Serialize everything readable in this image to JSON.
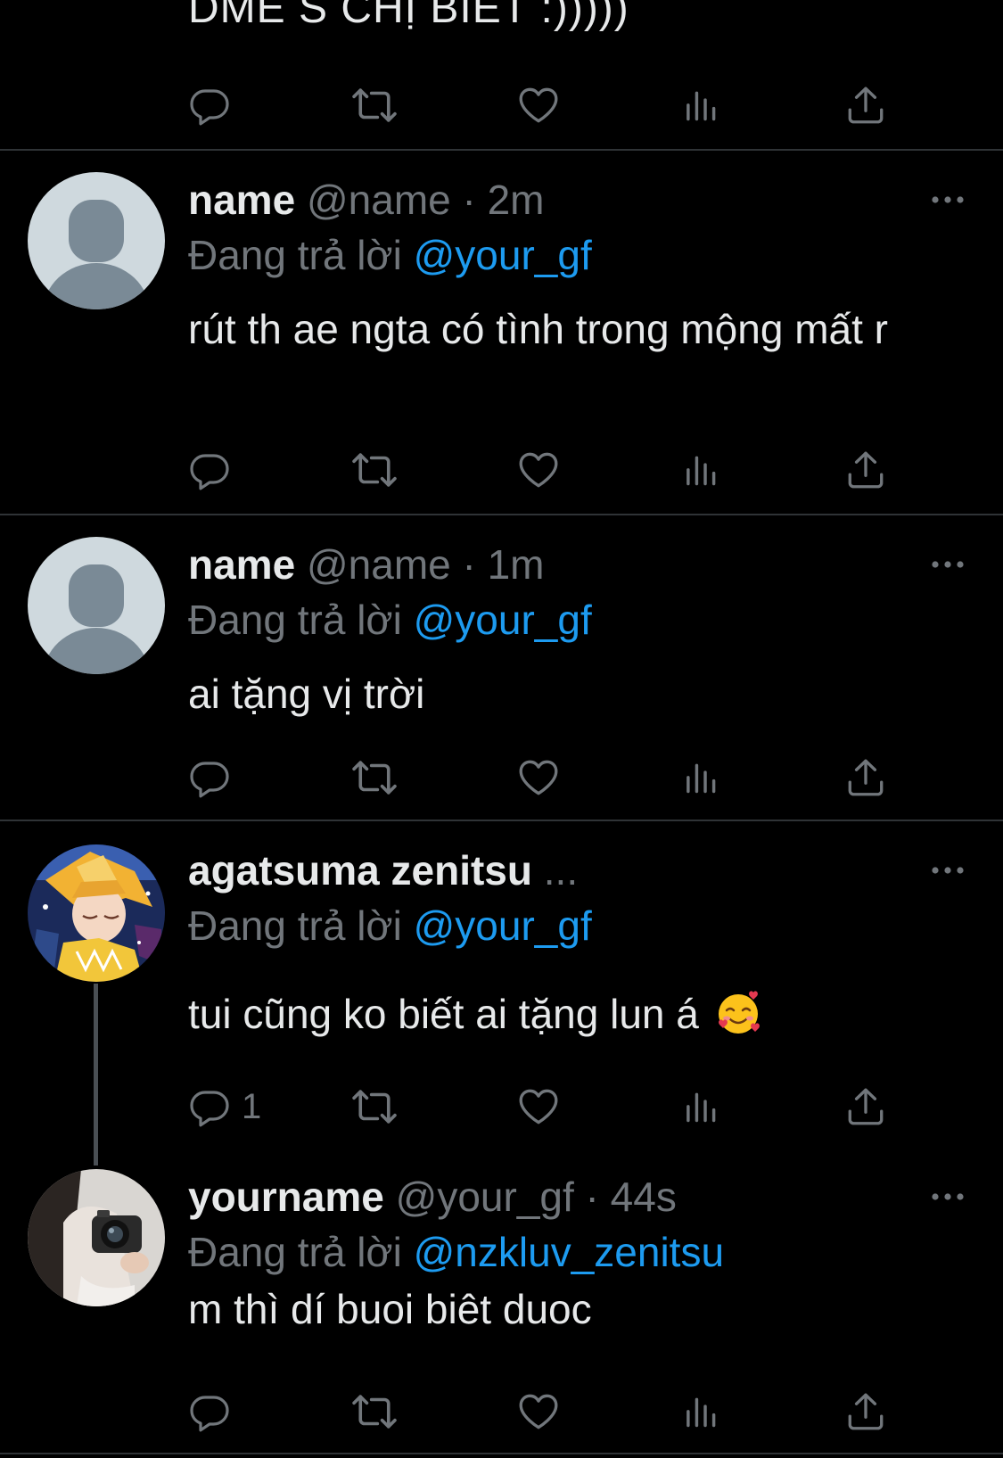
{
  "colors": {
    "background": "#000000",
    "primary_text": "#e7e9ea",
    "secondary_text": "#71767b",
    "link": "#1d9bf0",
    "divider": "#2f3336"
  },
  "top_fragment": {
    "text": "DME S CHỊ BIẾT :)))))"
  },
  "actions_icons": [
    "reply-icon",
    "retweet-icon",
    "like-icon",
    "views-icon",
    "share-icon"
  ],
  "tweets": [
    {
      "display_name": "name",
      "meta": "@name · 2m",
      "reply_prefix": "Đang trả lời",
      "reply_to": "@your_gf",
      "text": "rút th ae ngta có tình trong mộng mất r",
      "reply_count": ""
    },
    {
      "display_name": "name",
      "meta": "@name · 1m",
      "reply_prefix": "Đang trả lời",
      "reply_to": "@your_gf",
      "text": "ai tặng vị trời",
      "reply_count": ""
    },
    {
      "display_name": "agatsuma zenitsu",
      "meta": "...",
      "reply_prefix": "Đang trả lời",
      "reply_to": "@your_gf",
      "text": "tui cũng ko biết ai tặng lun á",
      "emoji": "smiling-face-with-hearts",
      "reply_count": "1"
    },
    {
      "display_name": "yourname",
      "meta": "@your_gf · 44s",
      "reply_prefix": "Đang trả lời",
      "reply_to": "@nzkluv_zenitsu",
      "text": "m thì dí buoi biêt duoc",
      "reply_count": ""
    }
  ]
}
